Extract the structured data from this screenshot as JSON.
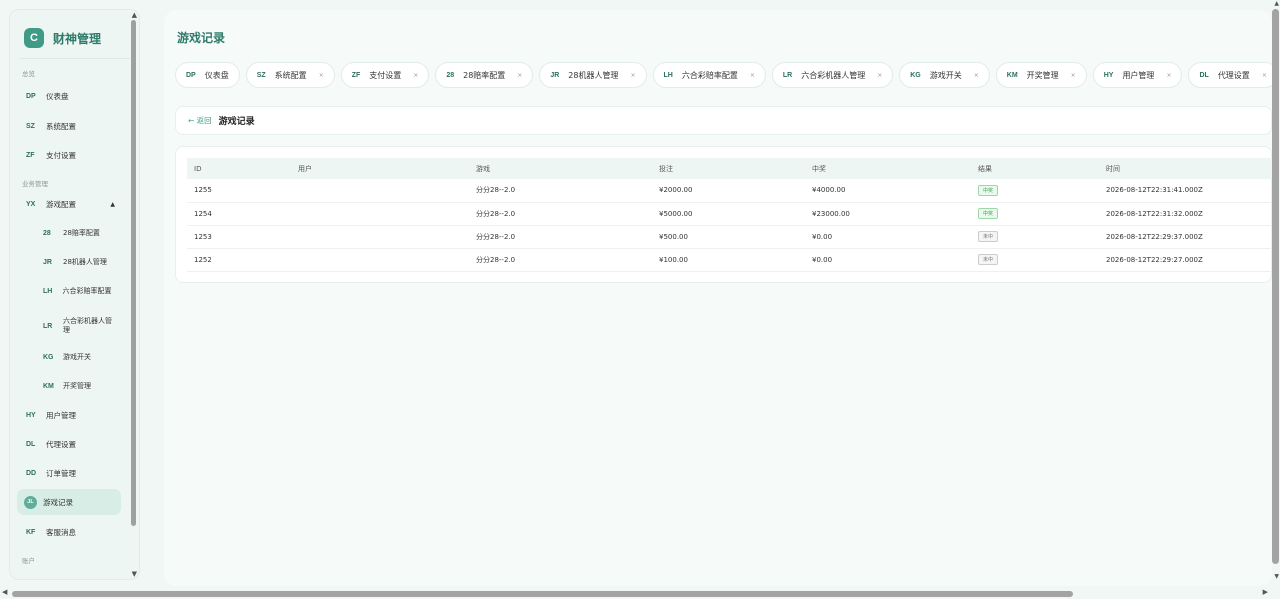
{
  "brand": {
    "logo": "C",
    "name": "财神管理"
  },
  "sidebar": {
    "sections": [
      "总览",
      "业务管理",
      "账户"
    ],
    "items": [
      {
        "code": "DP",
        "label": "仪表盘"
      },
      {
        "code": "SZ",
        "label": "系统配置"
      },
      {
        "code": "ZF",
        "label": "支付设置"
      },
      {
        "code": "YX",
        "label": "游戏配置"
      },
      {
        "code": "28",
        "label": "28赔率配置"
      },
      {
        "code": "JR",
        "label": "28机器人管理"
      },
      {
        "code": "LH",
        "label": "六合彩赔率配置"
      },
      {
        "code": "LR",
        "label": "六合彩机器人管理"
      },
      {
        "code": "KG",
        "label": "游戏开关"
      },
      {
        "code": "KM",
        "label": "开奖管理"
      },
      {
        "code": "HY",
        "label": "用户管理"
      },
      {
        "code": "DL",
        "label": "代理设置"
      },
      {
        "code": "DD",
        "label": "订单管理"
      },
      {
        "code": "JL",
        "label": "游戏记录"
      },
      {
        "code": "KF",
        "label": "客服消息"
      }
    ],
    "caret": "▲"
  },
  "main": {
    "title": "游戏记录",
    "tabs": [
      {
        "code": "DP",
        "label": "仪表盘",
        "closable": false
      },
      {
        "code": "SZ",
        "label": "系统配置",
        "closable": true
      },
      {
        "code": "ZF",
        "label": "支付设置",
        "closable": true
      },
      {
        "code": "28",
        "label": "28赔率配置",
        "closable": true
      },
      {
        "code": "JR",
        "label": "28机器人管理",
        "closable": true
      },
      {
        "code": "LH",
        "label": "六合彩赔率配置",
        "closable": true
      },
      {
        "code": "LR",
        "label": "六合彩机器人管理",
        "closable": true
      },
      {
        "code": "KG",
        "label": "游戏开关",
        "closable": true
      },
      {
        "code": "KM",
        "label": "开奖管理",
        "closable": true
      },
      {
        "code": "HY",
        "label": "用户管理",
        "closable": true
      },
      {
        "code": "DL",
        "label": "代理设置",
        "closable": true
      }
    ],
    "close_glyph": "×",
    "back_label": "← 返回",
    "card_title": "游戏记录",
    "table": {
      "headers": [
        "ID",
        "用户",
        "游戏",
        "投注",
        "中奖",
        "结果",
        "时间"
      ],
      "rows": [
        [
          "1255",
          "",
          "分分28--2.0",
          "¥2000.00",
          "¥4000.00",
          "中奖",
          "2026-08-12T22:31:41.000Z"
        ],
        [
          "1254",
          "",
          "分分28--2.0",
          "¥5000.00",
          "¥23000.00",
          "中奖",
          "2026-08-12T22:31:32.000Z"
        ],
        [
          "1253",
          "",
          "分分28--2.0",
          "¥500.00",
          "¥0.00",
          "未中",
          "2026-08-12T22:29:37.000Z"
        ],
        [
          "1252",
          "",
          "分分28--2.0",
          "¥100.00",
          "¥0.00",
          "未中",
          "2026-08-12T22:29:27.000Z"
        ]
      ]
    }
  },
  "colors": {
    "accent": "#3f9a86",
    "win": "#37a04d"
  }
}
